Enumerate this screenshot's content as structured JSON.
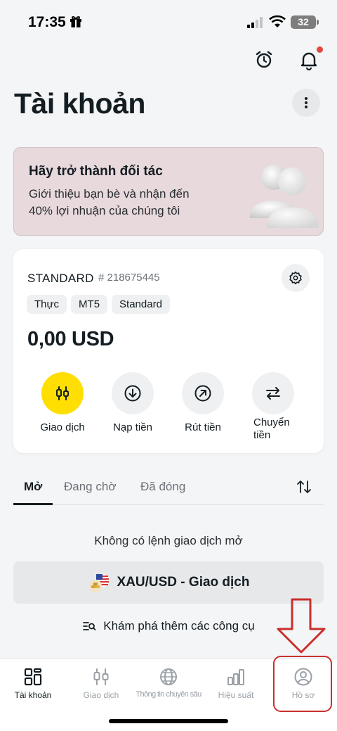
{
  "status_bar": {
    "time": "17:35",
    "battery": "32"
  },
  "header": {
    "title": "Tài khoản"
  },
  "partner_banner": {
    "title": "Hãy trở thành đối tác",
    "line1": "Giới thiệu bạn bè và nhận đến",
    "line2": "40% lợi nhuận của chúng tôi"
  },
  "account": {
    "type": "STANDARD",
    "number": "# 218675445",
    "tags": [
      "Thực",
      "MT5",
      "Standard"
    ],
    "balance": "0,00 USD",
    "actions": [
      {
        "label": "Giao dịch",
        "icon": "candlestick-icon"
      },
      {
        "label": "Nạp tiền",
        "icon": "deposit-icon"
      },
      {
        "label": "Rút tiền",
        "icon": "withdraw-icon"
      },
      {
        "label_line1": "Chuyển",
        "label_line2": "tiền",
        "icon": "transfer-icon"
      }
    ]
  },
  "order_tabs": [
    "Mở",
    "Đang chờ",
    "Đã đóng"
  ],
  "orders": {
    "empty_text": "Không có lệnh giao dịch mở",
    "trade_button": "XAU/USD - Giao dịch",
    "explore_link": "Khám phá thêm các công cụ"
  },
  "bottom_nav": [
    {
      "label": "Tài khoản",
      "icon": "accounts-grid-icon",
      "active": true
    },
    {
      "label": "Giao dịch",
      "icon": "candlestick-icon"
    },
    {
      "label": "Thông tin chuyên sâu",
      "icon": "globe-icon"
    },
    {
      "label": "Hiệu suất",
      "icon": "bar-chart-icon"
    },
    {
      "label": "Hồ sơ",
      "icon": "profile-icon"
    }
  ],
  "colors": {
    "accent": "#ffde02",
    "annotation": "#c9302c",
    "banner_bg": "#e8d9dc",
    "notification_dot": "#e5473d"
  }
}
